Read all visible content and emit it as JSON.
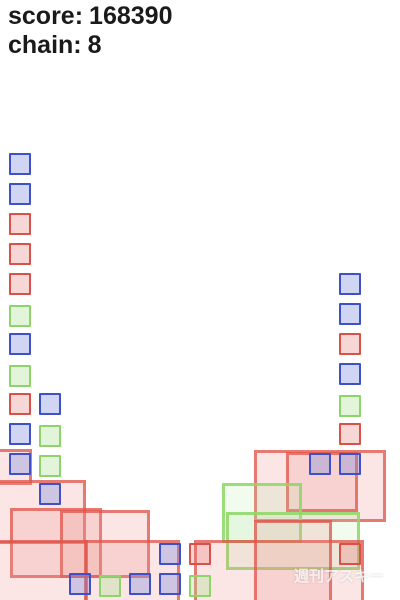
{
  "hud": {
    "score_label": "score:",
    "score_value": "168390",
    "chain_label": "chain:",
    "chain_value": "8"
  },
  "colors": {
    "blue": "#3f51c9",
    "red": "#d9524a",
    "green": "#8fd36b",
    "background": "#ffffff",
    "hud_text": "#1a1a1a"
  },
  "tile_colors_left_column_top_to_bottom": [
    "blue",
    "blue",
    "red",
    "red",
    "red",
    "green",
    "blue",
    "green",
    "red",
    "blue",
    "blue"
  ],
  "tile_colors_right_column_top_to_bottom": [
    "blue",
    "blue",
    "red",
    "blue",
    "green",
    "red",
    "blue"
  ],
  "watermark": {
    "text": "週刊アスキー"
  }
}
